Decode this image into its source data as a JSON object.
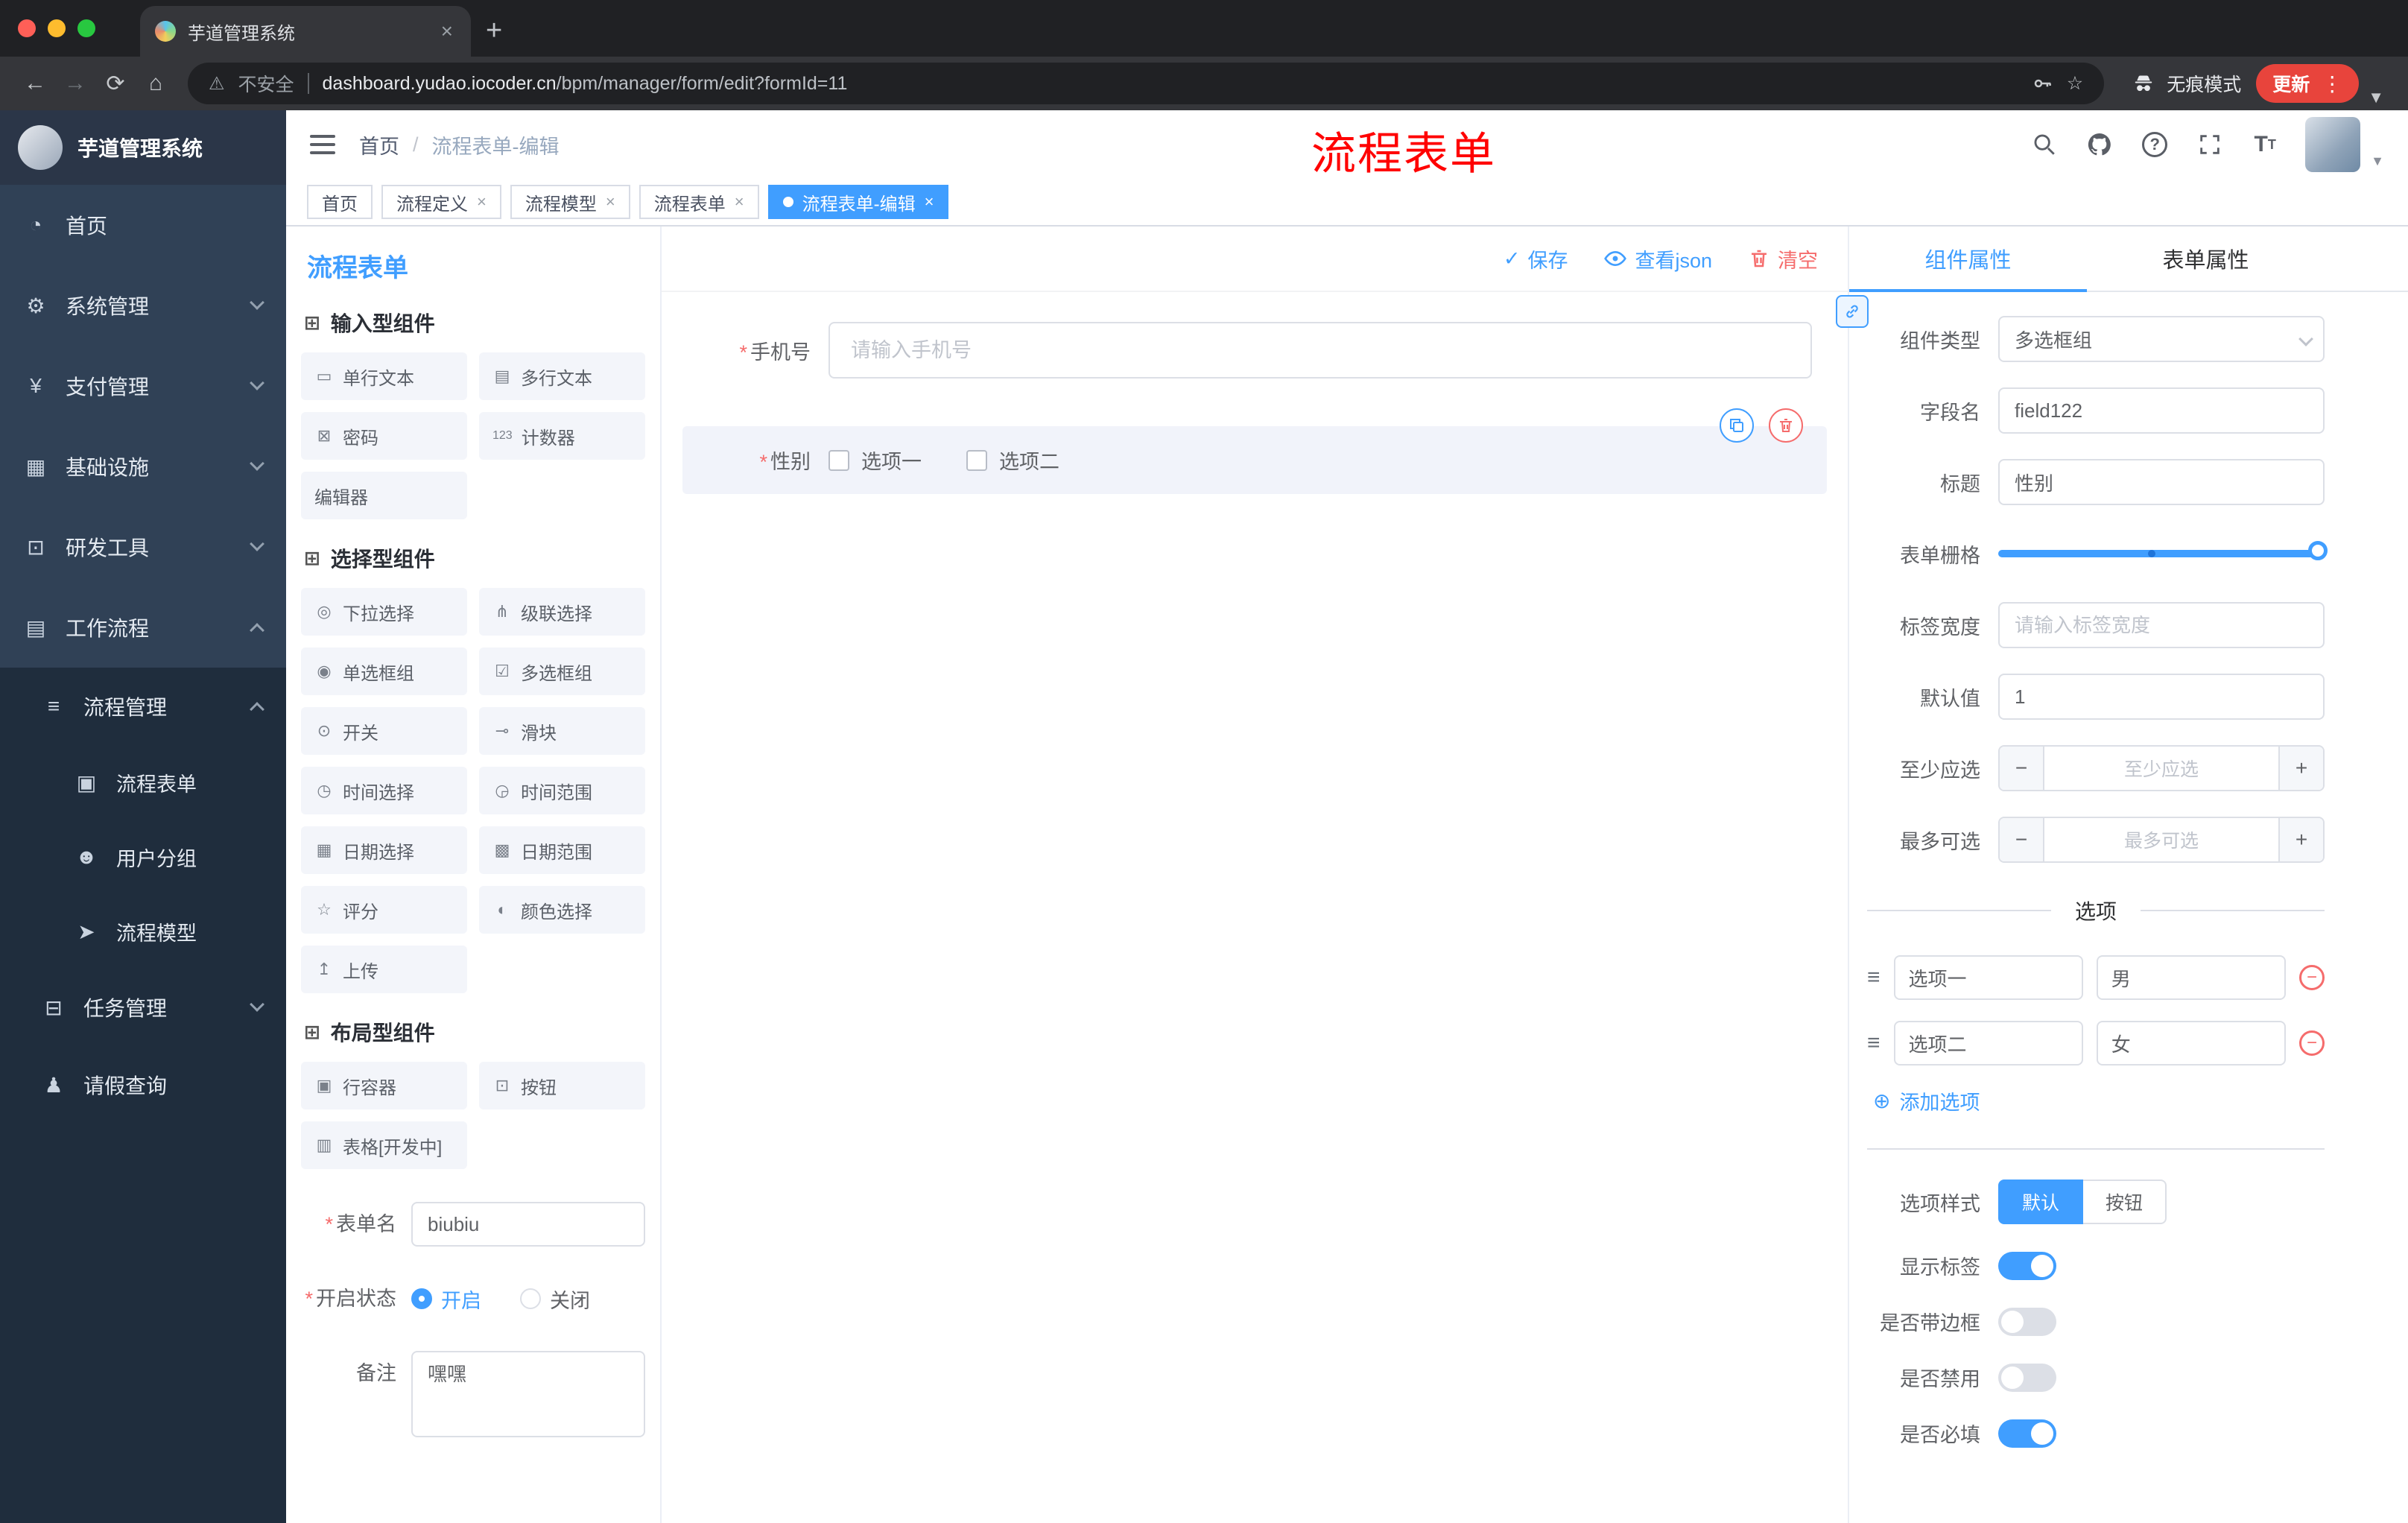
{
  "required_mark": "*",
  "browser": {
    "tab_title": "芋道管理系统",
    "security_label": "不安全",
    "url_domain": "dashboard.yudao.iocoder.cn",
    "url_path": "/bpm/manager/form/edit?formId=11",
    "incognito_label": "无痕模式",
    "update_label": "更新"
  },
  "annotation_title": "流程表单",
  "sidebar": {
    "logo_title": "芋道管理系统",
    "items": [
      {
        "label": "首页",
        "glyph": "◔"
      },
      {
        "label": "系统管理",
        "glyph": "⚙"
      },
      {
        "label": "支付管理",
        "glyph": "¥"
      },
      {
        "label": "基础设施",
        "glyph": "▦"
      },
      {
        "label": "研发工具",
        "glyph": "⊡"
      },
      {
        "label": "工作流程",
        "glyph": "▤"
      }
    ],
    "process_group": {
      "label": "流程管理",
      "glyph": "≡"
    },
    "process_children": [
      {
        "label": "流程表单",
        "glyph": "▣"
      },
      {
        "label": "用户分组",
        "glyph": "☻"
      },
      {
        "label": "流程模型",
        "glyph": "➤"
      }
    ],
    "task_item": {
      "label": "任务管理",
      "glyph": "⊟"
    },
    "leave_item": {
      "label": "请假查询",
      "glyph": "♟"
    }
  },
  "header": {
    "breadcrumb_home": "首页",
    "breadcrumb_sep": "/",
    "breadcrumb_current": "流程表单-编辑"
  },
  "tags": [
    {
      "label": "首页"
    },
    {
      "label": "流程定义"
    },
    {
      "label": "流程模型"
    },
    {
      "label": "流程表单"
    },
    {
      "label": "流程表单-编辑"
    }
  ],
  "designer": {
    "panel_title": "流程表单",
    "save_label": "保存",
    "view_json_label": "查看json",
    "clear_label": "清空",
    "groups": [
      {
        "title": "输入型组件",
        "items": [
          {
            "label": "单行文本",
            "glyph": "▭"
          },
          {
            "label": "多行文本",
            "glyph": "▤"
          },
          {
            "label": "密码",
            "glyph": "⊠"
          },
          {
            "label": "计数器",
            "glyph": "123"
          },
          {
            "label": "编辑器",
            "glyph": ""
          }
        ]
      },
      {
        "title": "选择型组件",
        "items": [
          {
            "label": "下拉选择",
            "glyph": "◎"
          },
          {
            "label": "级联选择",
            "glyph": "⋔"
          },
          {
            "label": "单选框组",
            "glyph": "◉"
          },
          {
            "label": "多选框组",
            "glyph": "☑"
          },
          {
            "label": "开关",
            "glyph": "⊙"
          },
          {
            "label": "滑块",
            "glyph": "⊸"
          },
          {
            "label": "时间选择",
            "glyph": "◷"
          },
          {
            "label": "时间范围",
            "glyph": "◶"
          },
          {
            "label": "日期选择",
            "glyph": "▦"
          },
          {
            "label": "日期范围",
            "glyph": "▩"
          },
          {
            "label": "评分",
            "glyph": "☆"
          },
          {
            "label": "颜色选择",
            "glyph": "◐"
          },
          {
            "label": "上传",
            "glyph": "↥"
          }
        ]
      },
      {
        "title": "布局型组件",
        "items": [
          {
            "label": "行容器",
            "glyph": "▣"
          },
          {
            "label": "按钮",
            "glyph": "⊡"
          },
          {
            "label": "表格[开发中]",
            "glyph": "▥"
          }
        ]
      }
    ],
    "meta_form": {
      "name_label": "表单名",
      "name_value": "biubiu",
      "status_label": "开启状态",
      "status_on": "开启",
      "status_off": "关闭",
      "remark_label": "备注",
      "remark_value": "嘿嘿"
    },
    "canvas": {
      "phone_label": "手机号",
      "phone_placeholder": "请输入手机号",
      "gender_label": "性别",
      "gender_option1": "选项一",
      "gender_option2": "选项二"
    }
  },
  "props": {
    "tab_component": "组件属性",
    "tab_form": "表单属性",
    "component_type_label": "组件类型",
    "component_type_value": "多选框组",
    "field_name_label": "字段名",
    "field_name_value": "field122",
    "title_label": "标题",
    "title_value": "性别",
    "grid_label": "表单栅格",
    "label_width_label": "标签宽度",
    "label_width_placeholder": "请输入标签宽度",
    "default_label": "默认值",
    "default_value": "1",
    "min_label": "至少应选",
    "min_placeholder": "至少应选",
    "max_label": "最多可选",
    "max_placeholder": "最多可选",
    "options_title": "选项",
    "options": [
      {
        "label": "选项一",
        "value": "男"
      },
      {
        "label": "选项二",
        "value": "女"
      }
    ],
    "add_option_label": "添加选项",
    "style_label": "选项样式",
    "style_default": "默认",
    "style_button": "按钮",
    "toggles": [
      {
        "label": "显示标签",
        "on": true
      },
      {
        "label": "是否带边框",
        "on": false
      },
      {
        "label": "是否禁用",
        "on": false
      },
      {
        "label": "是否必填",
        "on": true
      }
    ]
  }
}
